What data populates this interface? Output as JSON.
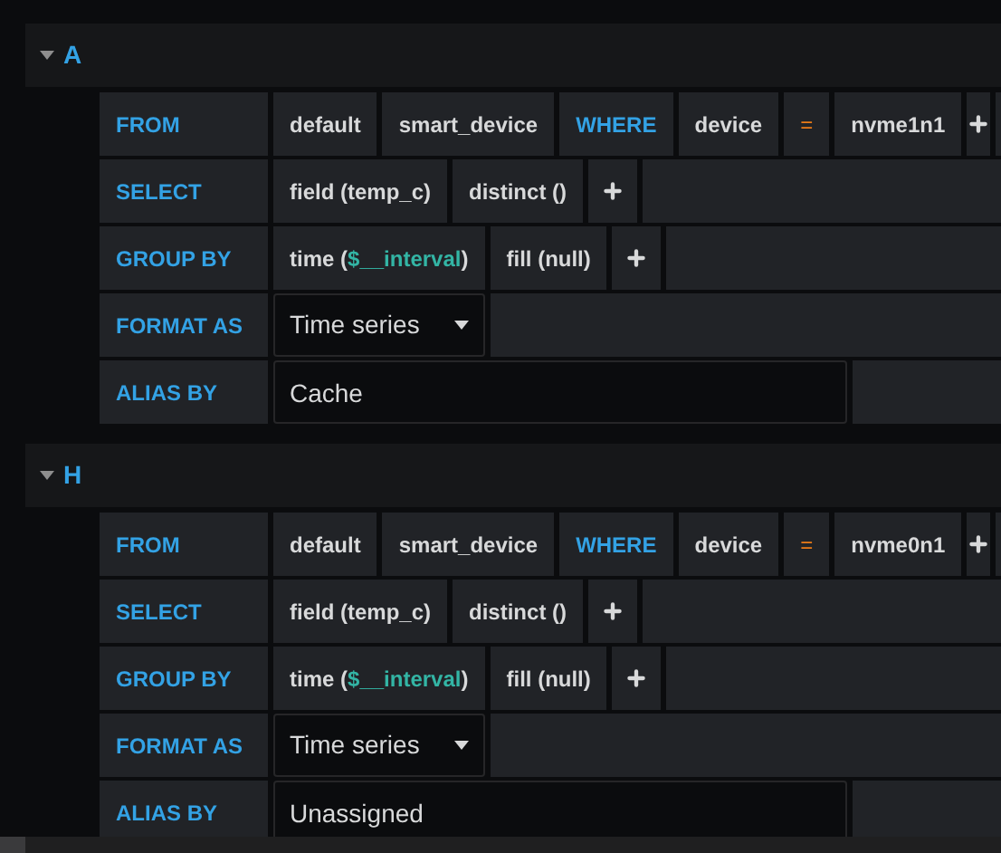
{
  "queries": [
    {
      "ref": "A",
      "expanded": true,
      "rows": [
        {
          "kind": "segments",
          "label": "FROM",
          "segments": [
            {
              "kind": "text",
              "text": "default"
            },
            {
              "kind": "text",
              "text": "smart_device"
            },
            {
              "kind": "keyword",
              "text": "WHERE"
            },
            {
              "kind": "text",
              "text": "device"
            },
            {
              "kind": "operator",
              "text": "="
            },
            {
              "kind": "text",
              "text": "nvme1n1"
            },
            {
              "kind": "plus"
            }
          ]
        },
        {
          "kind": "segments",
          "label": "SELECT",
          "segments": [
            {
              "kind": "text",
              "text": "field (temp_c)"
            },
            {
              "kind": "text",
              "text": "distinct ()"
            },
            {
              "kind": "plus"
            }
          ]
        },
        {
          "kind": "segments",
          "label": "GROUP BY",
          "segments": [
            {
              "kind": "func",
              "parts": [
                {
                  "text": "time (",
                  "variable": false
                },
                {
                  "text": "$__interval",
                  "variable": true
                },
                {
                  "text": ")",
                  "variable": false
                }
              ]
            },
            {
              "kind": "text",
              "text": "fill (null)"
            },
            {
              "kind": "plus"
            }
          ]
        },
        {
          "kind": "select",
          "label": "FORMAT AS",
          "value": "Time series"
        },
        {
          "kind": "input",
          "label": "ALIAS BY",
          "value": "Cache"
        }
      ]
    },
    {
      "ref": "H",
      "expanded": true,
      "rows": [
        {
          "kind": "segments",
          "label": "FROM",
          "segments": [
            {
              "kind": "text",
              "text": "default"
            },
            {
              "kind": "text",
              "text": "smart_device"
            },
            {
              "kind": "keyword",
              "text": "WHERE"
            },
            {
              "kind": "text",
              "text": "device"
            },
            {
              "kind": "operator",
              "text": "="
            },
            {
              "kind": "text",
              "text": "nvme0n1"
            },
            {
              "kind": "plus"
            }
          ]
        },
        {
          "kind": "segments",
          "label": "SELECT",
          "segments": [
            {
              "kind": "text",
              "text": "field (temp_c)"
            },
            {
              "kind": "text",
              "text": "distinct ()"
            },
            {
              "kind": "plus"
            }
          ]
        },
        {
          "kind": "segments",
          "label": "GROUP BY",
          "segments": [
            {
              "kind": "func",
              "parts": [
                {
                  "text": "time (",
                  "variable": false
                },
                {
                  "text": "$__interval",
                  "variable": true
                },
                {
                  "text": ")",
                  "variable": false
                }
              ]
            },
            {
              "kind": "text",
              "text": "fill (null)"
            },
            {
              "kind": "plus"
            }
          ]
        },
        {
          "kind": "select",
          "label": "FORMAT AS",
          "value": "Time series"
        },
        {
          "kind": "input",
          "label": "ALIAS BY",
          "value": "Unassigned"
        }
      ]
    }
  ]
}
